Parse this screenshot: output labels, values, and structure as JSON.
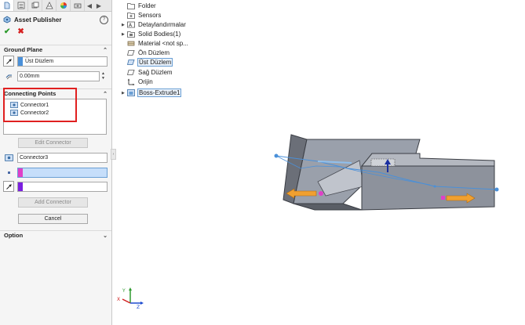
{
  "panel": {
    "title": "Asset Publisher",
    "help": "?",
    "ok": "✔",
    "cancel": "✖"
  },
  "ground_plane": {
    "heading": "Ground Plane",
    "plane_value": "Üst Düzlem",
    "offset_value": "0.00mm"
  },
  "connecting_points": {
    "heading": "Connecting Points",
    "items": [
      "Connector1",
      "Connector2"
    ],
    "edit_label": "Edit Connector",
    "name_value": "Connector3",
    "add_label": "Add Connector",
    "cancel_label": "Cancel"
  },
  "option": {
    "heading": "Option"
  },
  "tree": {
    "items": [
      {
        "label": "Folder",
        "icon": "folder-icon"
      },
      {
        "label": "Sensors",
        "icon": "sensors-icon"
      },
      {
        "label": "Detaylandırmalar",
        "icon": "annotations-icon"
      },
      {
        "label": "Solid Bodies(1)",
        "icon": "solid-bodies-icon"
      },
      {
        "label": "Material <not sp...",
        "icon": "material-icon"
      },
      {
        "label": "Ön Düzlem",
        "icon": "plane-icon"
      },
      {
        "label": "Üst Düzlem",
        "icon": "plane-icon"
      },
      {
        "label": "Sağ Düzlem",
        "icon": "plane-icon"
      },
      {
        "label": "Orijin",
        "icon": "origin-icon"
      },
      {
        "label": "Boss-Extrude1",
        "icon": "extrude-icon"
      }
    ]
  },
  "triad": {
    "x": "X",
    "y": "Y",
    "z": "Z"
  },
  "colors": {
    "accent": "#4a90d9",
    "selection_blue": "#c6defa",
    "magenta": "#e040c8",
    "purple": "#7b1fe0",
    "orange": "#f0a030",
    "red_highlight": "#e02020"
  }
}
